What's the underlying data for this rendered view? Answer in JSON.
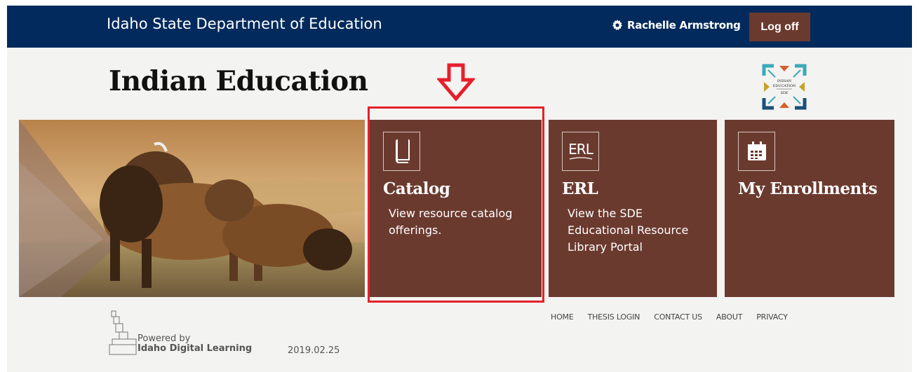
{
  "header": {
    "site_title": "Idaho State Department of Education",
    "user_name": "Rachelle Armstrong",
    "logoff_label": "Log off",
    "bar_color": "#022a5c"
  },
  "page": {
    "title": "Indian Education",
    "logo_text_line1": "INDIAN",
    "logo_text_line2": "EDUCATION",
    "logo_text_line3": "SDE"
  },
  "tiles": [
    {
      "title": "Catalog",
      "description": "View resource catalog offerings.",
      "icon": "book-icon"
    },
    {
      "title": "ERL",
      "description": "View the SDE Educational Resource Library Portal",
      "icon": "erl-icon",
      "icon_text": "ERL"
    },
    {
      "title": "My Enrollments",
      "description": "",
      "icon": "calendar-icon"
    }
  ],
  "tile_color": "#6b3a2e",
  "highlight_color": "#e51f2b",
  "footer": {
    "links": [
      "HOME",
      "THESIS LOGIN",
      "CONTACT US",
      "ABOUT",
      "PRIVACY"
    ],
    "powered_by": "Powered by",
    "powered_org": "Idaho Digital Learning",
    "version": "2019.02.25"
  }
}
